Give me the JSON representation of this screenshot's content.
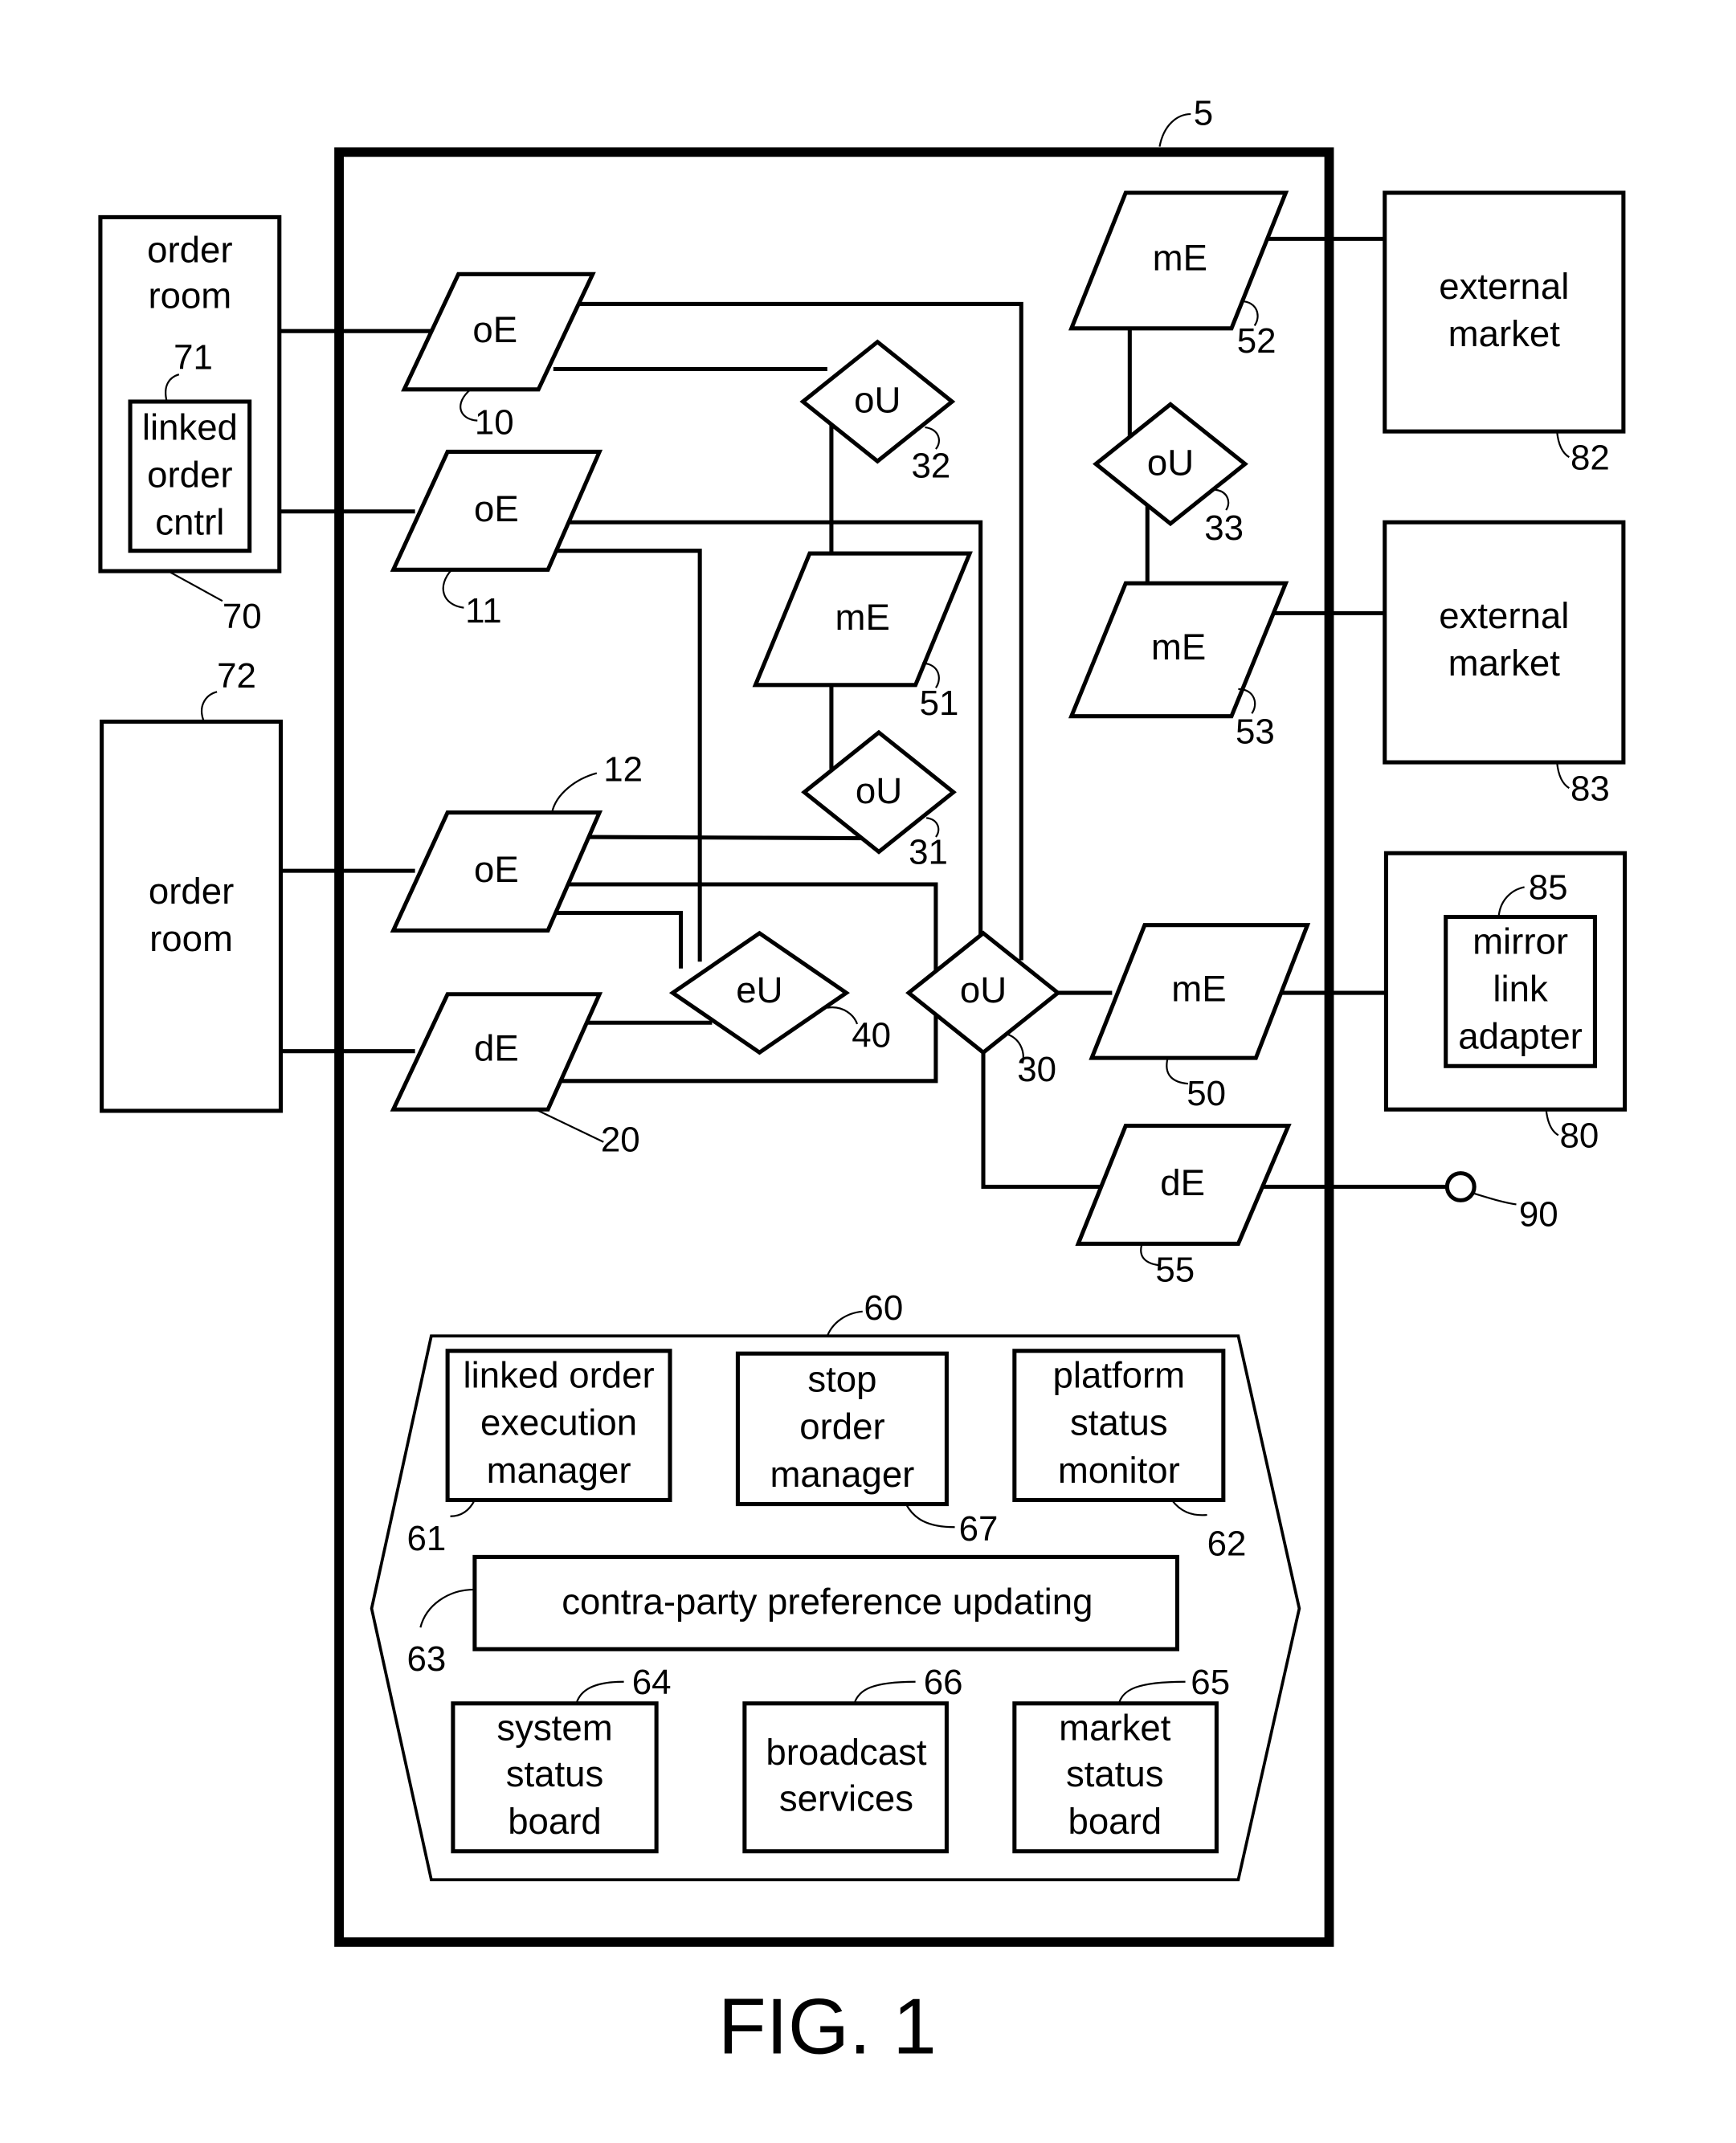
{
  "figure": {
    "caption": "FIG. 1",
    "system_ref": "5"
  },
  "external": {
    "order_room_70": {
      "lines": [
        "order",
        "room"
      ],
      "ref": "70"
    },
    "linked_order_cntrl_71": {
      "lines": [
        "linked",
        "order",
        "cntrl"
      ],
      "ref": "71"
    },
    "order_room_72": {
      "lines": [
        "order",
        "room"
      ],
      "ref": "72"
    },
    "external_market_82": {
      "lines": [
        "external",
        "market"
      ],
      "ref": "82"
    },
    "external_market_83": {
      "lines": [
        "external",
        "market"
      ],
      "ref": "83"
    },
    "mirror_box_80": {
      "ref": "80"
    },
    "mirror_link_adapter_85": {
      "lines": [
        "mirror",
        "link",
        "adapter"
      ],
      "ref": "85"
    },
    "terminal_90": {
      "ref": "90"
    }
  },
  "nodes": {
    "oE10": {
      "label": "oE",
      "ref": "10"
    },
    "oE11": {
      "label": "oE",
      "ref": "11"
    },
    "oE12": {
      "label": "oE",
      "ref": "12"
    },
    "dE20": {
      "label": "dE",
      "ref": "20"
    },
    "oU30": {
      "label": "oU",
      "ref": "30"
    },
    "oU31": {
      "label": "oU",
      "ref": "31"
    },
    "oU32": {
      "label": "oU",
      "ref": "32"
    },
    "oU33": {
      "label": "oU",
      "ref": "33"
    },
    "eU40": {
      "label": "eU",
      "ref": "40"
    },
    "mE50": {
      "label": "mE",
      "ref": "50"
    },
    "mE51": {
      "label": "mE",
      "ref": "51"
    },
    "mE52": {
      "label": "mE",
      "ref": "52"
    },
    "mE53": {
      "label": "mE",
      "ref": "53"
    },
    "dE55": {
      "label": "dE",
      "ref": "55"
    }
  },
  "services": {
    "ref": "60",
    "linked_order_execution_manager": {
      "lines": [
        "linked order",
        "execution",
        "manager"
      ],
      "ref": "61"
    },
    "stop_order_manager": {
      "lines": [
        "stop",
        "order",
        "manager"
      ],
      "ref": "67"
    },
    "platform_status_monitor": {
      "lines": [
        "platform",
        "status",
        "monitor"
      ],
      "ref": "62"
    },
    "contra_party_preference_updating": {
      "lines": [
        "contra-party preference updating"
      ],
      "ref": "63"
    },
    "system_status_board": {
      "lines": [
        "system",
        "status",
        "board"
      ],
      "ref": "64"
    },
    "broadcast_services": {
      "lines": [
        "broadcast",
        "services"
      ],
      "ref": "66"
    },
    "market_status_board": {
      "lines": [
        "market",
        "status",
        "board"
      ],
      "ref": "65"
    }
  }
}
